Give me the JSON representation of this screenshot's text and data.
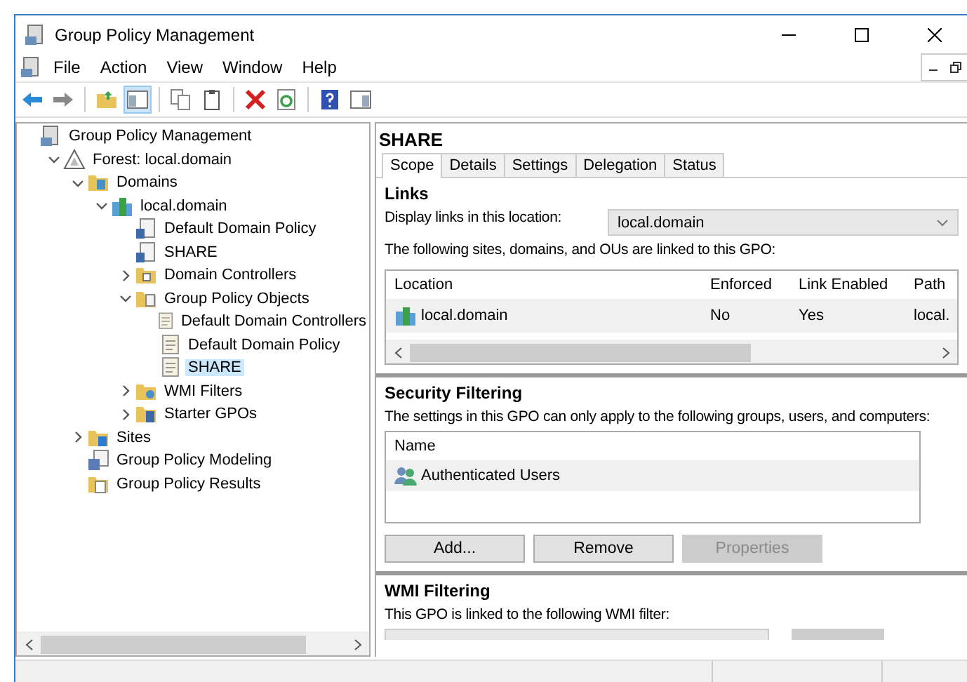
{
  "window": {
    "title": "Group Policy Management"
  },
  "menu": [
    "File",
    "Action",
    "View",
    "Window",
    "Help"
  ],
  "toolbar": [
    {
      "kind": "back"
    },
    {
      "kind": "forward"
    },
    {
      "kind": "sep"
    },
    {
      "kind": "up"
    },
    {
      "kind": "pane",
      "selected": true
    },
    {
      "kind": "sep"
    },
    {
      "kind": "copy"
    },
    {
      "kind": "paste"
    },
    {
      "kind": "sep"
    },
    {
      "kind": "delete"
    },
    {
      "kind": "refresh"
    },
    {
      "kind": "sep"
    },
    {
      "kind": "help"
    },
    {
      "kind": "view"
    }
  ],
  "tree": [
    {
      "label": "Group Policy Management",
      "kind": "console",
      "selected": false,
      "children": [
        {
          "label": "Forest: local.domain",
          "kind": "forest",
          "expanded": true,
          "selected": false,
          "children": [
            {
              "label": "Domains",
              "kind": "domains",
              "expanded": true,
              "selected": false,
              "children": [
                {
                  "label": "local.domain",
                  "kind": "domain",
                  "expanded": true,
                  "selected": false,
                  "children": [
                    {
                      "label": "Default Domain Policy",
                      "kind": "link",
                      "selected": false
                    },
                    {
                      "label": "SHARE",
                      "kind": "link",
                      "selected": false
                    },
                    {
                      "label": "Domain Controllers",
                      "kind": "ou",
                      "expanded": false,
                      "selected": false
                    },
                    {
                      "label": "Group Policy Objects",
                      "kind": "gpofolder",
                      "expanded": true,
                      "selected": false,
                      "children": [
                        {
                          "label": "Default Domain Controllers",
                          "kind": "gpo",
                          "selected": false
                        },
                        {
                          "label": "Default Domain Policy",
                          "kind": "gpo",
                          "selected": false
                        },
                        {
                          "label": "SHARE",
                          "kind": "gpo",
                          "selected": true
                        }
                      ]
                    },
                    {
                      "label": "WMI Filters",
                      "kind": "wmi",
                      "expanded": false,
                      "selected": false
                    },
                    {
                      "label": "Starter GPOs",
                      "kind": "starter",
                      "expanded": false,
                      "selected": false
                    }
                  ]
                }
              ]
            },
            {
              "label": "Sites",
              "kind": "sites",
              "expanded": false,
              "selected": false
            },
            {
              "label": "Group Policy Modeling",
              "kind": "modeling",
              "selected": false
            },
            {
              "label": "Group Policy Results",
              "kind": "results",
              "selected": false
            }
          ]
        }
      ]
    }
  ],
  "details": {
    "title": "SHARE",
    "tabs": [
      {
        "label": "Scope",
        "selected": true
      },
      {
        "label": "Details",
        "selected": false
      },
      {
        "label": "Settings",
        "selected": false
      },
      {
        "label": "Delegation",
        "selected": false
      },
      {
        "label": "Status",
        "selected": false
      }
    ],
    "links": {
      "heading": "Links",
      "location_label": "Display links in this location:",
      "location_value": "local.domain",
      "caption": "The following sites, domains, and OUs are linked to this GPO:",
      "columns": [
        "Location",
        "Enforced",
        "Link Enabled",
        "Path"
      ],
      "rows": [
        [
          "local.domain",
          "No",
          "Yes",
          "local."
        ]
      ]
    },
    "security": {
      "heading": "Security Filtering",
      "caption": "The settings in this GPO can only apply to the following groups, users, and computers:",
      "column": "Name",
      "rows": [
        "Authenticated Users"
      ],
      "buttons": [
        {
          "label": "Add...",
          "disabled": false
        },
        {
          "label": "Remove",
          "disabled": false
        },
        {
          "label": "Properties",
          "disabled": true
        }
      ]
    },
    "wmi": {
      "heading": "WMI Filtering",
      "caption": "This GPO is linked to the following WMI filter:"
    }
  }
}
